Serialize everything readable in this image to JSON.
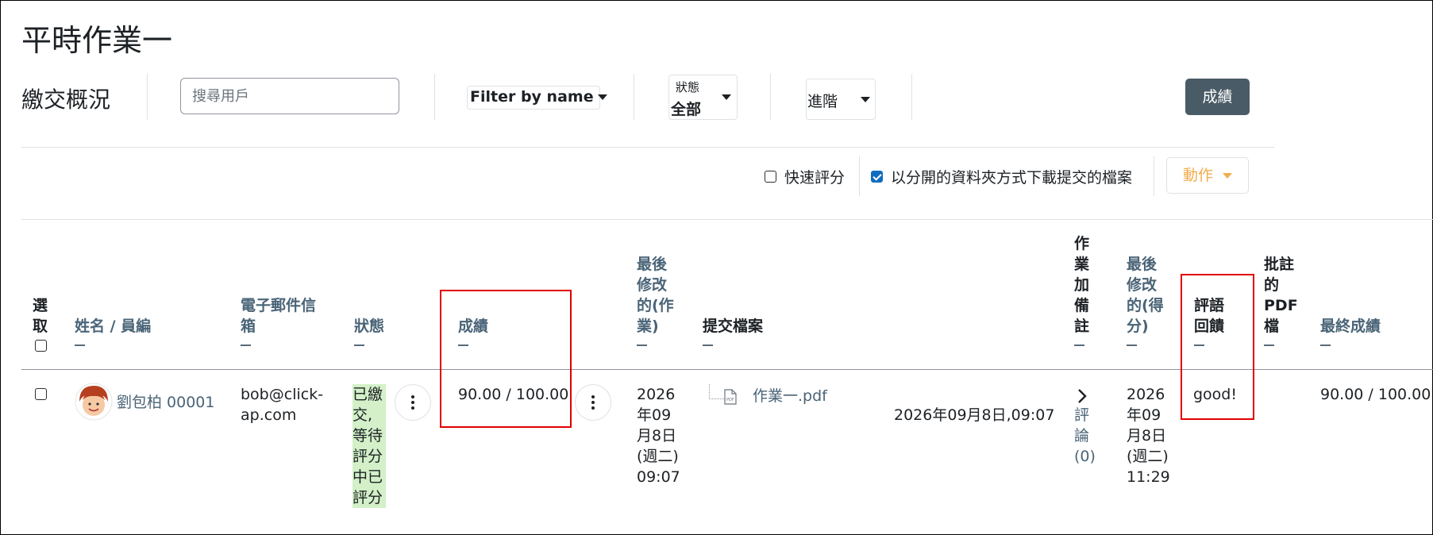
{
  "page": {
    "title": "平時作業一",
    "section_title": "繳交概況"
  },
  "toolbar": {
    "search_placeholder": "搜尋用戶",
    "filter_label": "Filter by name",
    "status_label": "狀態",
    "status_value": "全部",
    "advanced_label": "進階",
    "grade_button": "成績"
  },
  "options": {
    "quick_grading_label": "快速評分",
    "quick_grading_checked": false,
    "download_folders_label": "以分開的資料夾方式下載提交的檔案",
    "download_folders_checked": true,
    "actions_label": "動作"
  },
  "table": {
    "headers": {
      "select": "選取",
      "name": "姓名 / 員編",
      "email": "電子郵件信箱",
      "status": "狀態",
      "grade": "成績",
      "last_modified_submission": "最後修改的(作業)",
      "files": "提交檔案",
      "submission_comments": "作業加備註",
      "last_modified_grade": "最後修改的(得分)",
      "feedback_comments": "評語回饋",
      "annotated_pdf": "批註的PDF檔",
      "final_grade": "最終成績"
    },
    "row": {
      "name": "劉包柏 00001",
      "email": "bob@click-ap.com",
      "status": "已繳交,等待評分中已評分",
      "grade": "90.00 / 100.00",
      "last_modified_submission": "2026年09月8日(週二) 09:07",
      "file_name": "作業一.pdf",
      "file_time": "2026年09月8日,09:07",
      "comments": "評論(0)",
      "last_modified_grade": "2026年09月8日(週二) 11:29",
      "feedback": "good!",
      "final_grade": "90.00 / 100.00"
    }
  },
  "colors": {
    "link": "#4a6477",
    "primary_button": "#495b66",
    "status_submitted_bg": "#d3f0c8",
    "highlight_border": "#e00000",
    "actions_text": "#f0ad4e"
  }
}
